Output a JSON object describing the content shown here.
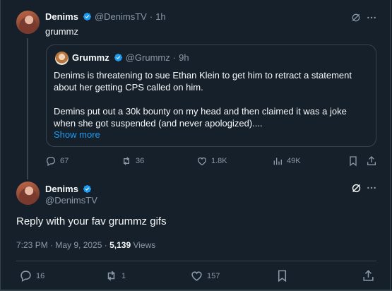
{
  "colors": {
    "background": "#15202b",
    "text": "#f7f9f9",
    "muted": "#8b98a5",
    "link": "#1d9bf0",
    "verified": "#1d9bf0",
    "border": "#38444d"
  },
  "reply_tweet": {
    "author_name": "Denims",
    "handle": "@DenimsTV",
    "separator": "·",
    "time": "1h",
    "text": "grummz",
    "quote": {
      "author_name": "Grummz",
      "handle": "@Grummz",
      "separator": "·",
      "time": "9h",
      "paragraph1": "Denims is threatening to sue Ethan Klein to get him to retract a statement about her getting CPS called on him.",
      "paragraph2": "Demins put out a 30k bounty on my head and then claimed it was a joke when she got suspended (and never apologized)....",
      "show_more": "Show more"
    },
    "actions": {
      "replies": "67",
      "reposts": "36",
      "likes": "1.8K",
      "views": "49K"
    }
  },
  "main_tweet": {
    "author_name": "Denims",
    "handle": "@DenimsTV",
    "text": "Reply with your fav grummz gifs",
    "timestamp": "7:23 PM · May 9, 2025",
    "dot": "·",
    "views_count": "5,139",
    "views_label": "Views",
    "actions": {
      "replies": "16",
      "reposts": "1",
      "likes": "157"
    }
  },
  "icons": [
    "grok-icon",
    "more-icon",
    "reply-icon",
    "repost-icon",
    "like-icon",
    "views-icon",
    "bookmark-icon",
    "share-icon",
    "verified-badge-icon"
  ]
}
